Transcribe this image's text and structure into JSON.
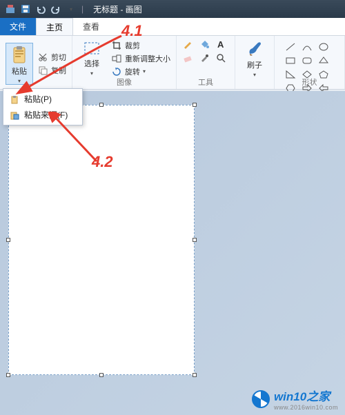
{
  "title": "无标题 - 画图",
  "tabs": {
    "file": "文件",
    "home": "主页",
    "view": "查看"
  },
  "clipboard": {
    "paste": "粘贴",
    "cut": "剪切",
    "copy": "复制",
    "group_label": ""
  },
  "select": {
    "label": "选择"
  },
  "image": {
    "crop": "裁剪",
    "resize": "重新调整大小",
    "rotate": "旋转",
    "group_label": "图像"
  },
  "tools": {
    "group_label": "工具"
  },
  "brush": {
    "label": "刷子"
  },
  "shapes": {
    "group_label": "形状"
  },
  "dropdown": {
    "paste": "粘贴(P)",
    "paste_from": "粘贴来源(F)"
  },
  "annotations": {
    "a1": "4.1",
    "a2": "4.2"
  },
  "watermark": {
    "brand": "win10之家",
    "url": "www.2016win10.com"
  }
}
